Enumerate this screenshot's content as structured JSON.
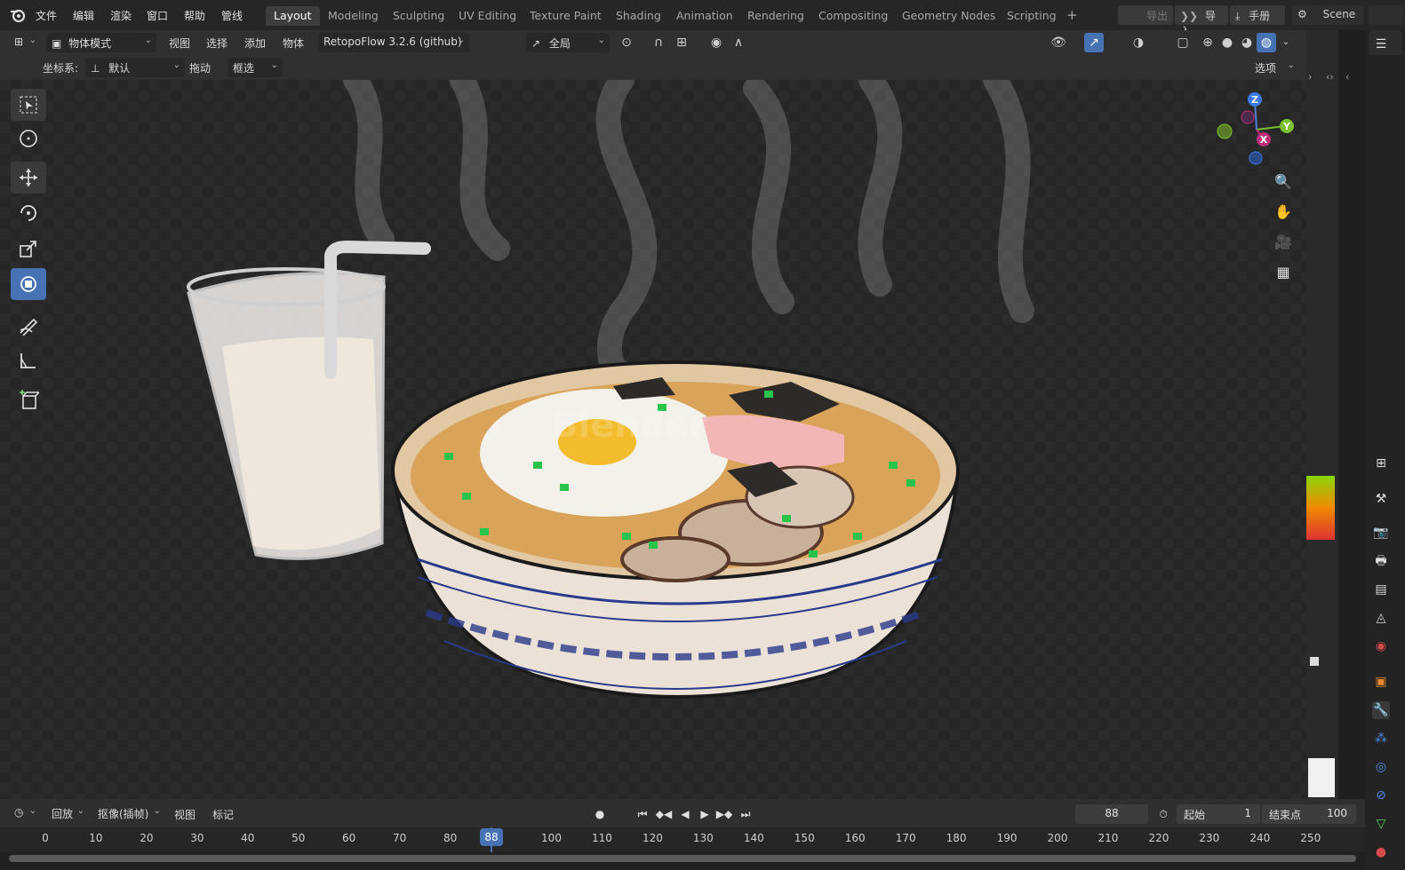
{
  "topbar": {
    "menus": [
      "文件",
      "编辑",
      "渲染",
      "窗口",
      "帮助",
      "管线"
    ],
    "workspace_tabs": [
      "Layout",
      "Modeling",
      "Sculpting",
      "UV Editing",
      "Texture Paint",
      "Shading",
      "Animation",
      "Rendering",
      "Compositing",
      "Geometry Nodes",
      "Scripting"
    ],
    "active_tab": "Layout",
    "add_tab": "+",
    "export_label": "导出",
    "import_label": "导入",
    "manual_label": "手册",
    "scene_label": "Scene"
  },
  "header1": {
    "mode": "物体模式",
    "menus": [
      "视图",
      "选择",
      "添加",
      "物体"
    ],
    "addon": "RetopoFlow 3.2.6 (github)",
    "transform_orientation": "全局"
  },
  "header2": {
    "coord_label": "坐标系:",
    "coord_value": "默认",
    "drag_label": "拖动",
    "select_mode": "框选",
    "options_label": "选项"
  },
  "gizmo": {
    "z": "Z",
    "y": "Y",
    "x": "X"
  },
  "watermark": "Blender",
  "timeline": {
    "playback": "回放",
    "keying": "抠像(插帧)",
    "view": "视图",
    "marker": "标记",
    "current_frame": "88",
    "start_label": "起始",
    "start_value": "1",
    "end_label": "结束点",
    "end_value": "100",
    "ticks": [
      "0",
      "10",
      "20",
      "30",
      "40",
      "50",
      "60",
      "70",
      "80",
      "90",
      "100",
      "110",
      "120",
      "130",
      "140",
      "150",
      "160",
      "170",
      "180",
      "190",
      "200",
      "210",
      "220",
      "230",
      "240",
      "250"
    ]
  },
  "colors": {
    "accent": "#4772b3",
    "frame_marker": "#4772b3",
    "bowl_rim": "#2a3a8a"
  }
}
